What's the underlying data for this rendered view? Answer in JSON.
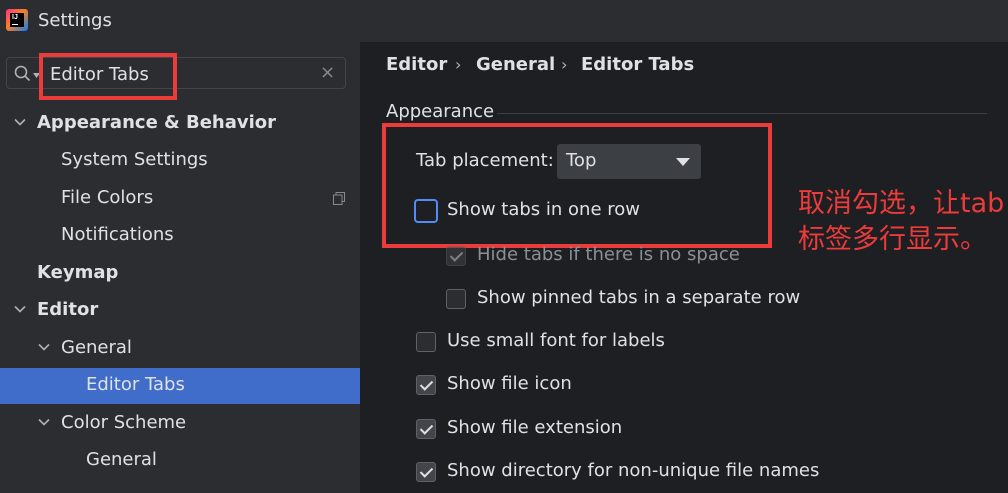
{
  "window": {
    "title": "Settings",
    "logo_text": "IJ"
  },
  "search": {
    "value": "Editor Tabs",
    "clear_glyph": "×"
  },
  "sidebar": {
    "items": [
      {
        "label": "Appearance & Behavior",
        "expanded": true
      },
      {
        "label": "System Settings"
      },
      {
        "label": "File Colors",
        "badge_icon": "copy-icon"
      },
      {
        "label": "Notifications"
      },
      {
        "label": "Keymap"
      },
      {
        "label": "Editor",
        "expanded": true
      },
      {
        "label": "General",
        "expanded": true
      },
      {
        "label": "Editor Tabs",
        "selected": true
      },
      {
        "label": "Color Scheme",
        "expanded": true
      },
      {
        "label": "General"
      }
    ]
  },
  "breadcrumb": {
    "items": [
      "Editor",
      "General",
      "Editor Tabs"
    ],
    "separator": "›"
  },
  "appearance": {
    "group_label": "Appearance",
    "tab_placement": {
      "label": "Tab placement:",
      "value": "Top"
    },
    "options": [
      {
        "label": "Show tabs in one row",
        "checked": false
      },
      {
        "label": "Hide tabs if there is no space",
        "checked": true,
        "disabled": true
      },
      {
        "label": "Show pinned tabs in a separate row",
        "checked": false
      },
      {
        "label": "Use small font for labels",
        "checked": false
      },
      {
        "label": "Show file icon",
        "checked": true
      },
      {
        "label": "Show file extension",
        "checked": true
      },
      {
        "label": "Show directory for non-unique file names",
        "checked": true
      }
    ]
  },
  "annotation": {
    "text": "取消勾选，让tab标签多行显示。"
  },
  "colors": {
    "highlight": "#ec3b3b",
    "selection": "#3f6dc9",
    "focus": "#548af7"
  }
}
